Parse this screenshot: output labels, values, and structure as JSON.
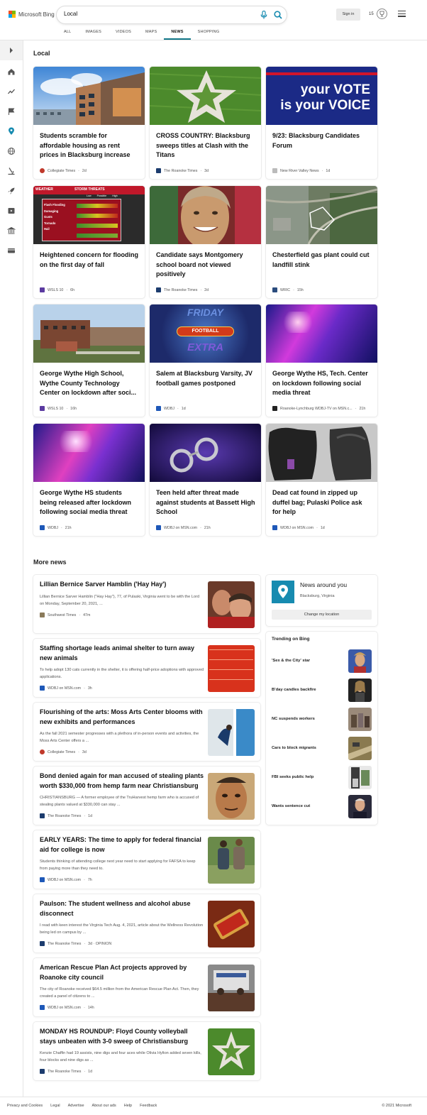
{
  "header": {
    "brand": "Microsoft Bing",
    "search_value": "Local",
    "signin_label": "Sign in",
    "rewards_count": "15"
  },
  "tabs": [
    {
      "label": "ALL"
    },
    {
      "label": "IMAGES"
    },
    {
      "label": "VIDEOS"
    },
    {
      "label": "MAPS"
    },
    {
      "label": "NEWS"
    },
    {
      "label": "SHOPPING"
    }
  ],
  "active_tab": "NEWS",
  "accent_color": "#178bb0",
  "local": {
    "title": "Local",
    "cards": [
      {
        "title": "Students scramble for affordable housing as rent prices in Blacksburg increase",
        "source": "Collegiate Times",
        "age": "2d"
      },
      {
        "title": "CROSS COUNTRY: Blacksburg sweeps titles at Clash with the Titans",
        "source": "The Roanoke Times",
        "age": "3d"
      },
      {
        "title": "9/23: Blacksburg Candidates Forum",
        "source": "New River Valley News",
        "age": "1d",
        "image_text": [
          "your VOTE",
          "is your VOICE"
        ]
      },
      {
        "title": "Heightened concern for flooding on the first day of fall",
        "source": "WSLS 10",
        "age": "6h",
        "image_text": [
          "WEATHER",
          "STORM THREATS",
          "Flash Flooding",
          "Damaging Gusts",
          "Tornado",
          "Hail",
          "Low",
          "Possible",
          "High"
        ]
      },
      {
        "title": "Candidate says Montgomery school board not viewed positively",
        "source": "The Roanoke Times",
        "age": "2d"
      },
      {
        "title": "Chesterfield gas plant could cut landfill stink",
        "source": "WRIC",
        "age": "15h"
      },
      {
        "title": "George Wythe High School, Wythe County Technology Center on lockdown after soci...",
        "source": "WSLS 10",
        "age": "16h"
      },
      {
        "title": "Salem at Blacksburg Varsity, JV football games postponed",
        "source": "WDBJ",
        "age": "1d",
        "image_text": [
          "FRIDAY",
          "FOOTBALL",
          "EXTRA"
        ]
      },
      {
        "title": "George Wythe HS, Tech. Center on lockdown following social media threat",
        "source": "Roanoke-Lynchburg WDBJ-TV on MSN.c...",
        "age": "21h"
      },
      {
        "title": "George Wythe HS students being released after lockdown following social media threat",
        "source": "WDBJ",
        "age": "21h"
      },
      {
        "title": "Teen held after threat made against students at Bassett High School",
        "source": "WDBJ on MSN.com",
        "age": "21h"
      },
      {
        "title": "Dead cat found in zipped up duffel bag; Pulaski Police ask for help",
        "source": "WDBJ on MSN.com",
        "age": "1d"
      }
    ]
  },
  "more_news": {
    "title": "More news",
    "items": [
      {
        "title": "Lillian Bernice Sarver Hamblin ('Hay Hay')",
        "snippet": "Lillian Bernice Sarver Hamblin (\"Hay Hay\"), 77, of Pulaski, Virginia went to be with the Lord on Monday, September 20, 2021, ...",
        "source": "Southwest Times",
        "age": "47m"
      },
      {
        "title": "Staffing shortage leads animal shelter to turn away new animals",
        "snippet": "To help adopt 130 cats currently in the shelter, it is offering half-price adoptions with approved applications.",
        "source": "WDBJ on MSN.com",
        "age": "3h"
      },
      {
        "title": "Flourishing of the arts: Moss Arts Center blooms with new exhibits and performances",
        "snippet": "As the fall 2021 semester progresses with a plethora of in-person events and activities, the Moss Arts Center offers a ...",
        "source": "Collegiate Times",
        "age": "3d"
      },
      {
        "title": "Bond denied again for man accused of stealing plants worth $330,000 from hemp farm near Christiansburg",
        "snippet": "CHRISTIANSBURG — A former employee of the TruHarvest hemp farm who is accused of stealing plants valued at $330,000 can stay ...",
        "source": "The Roanoke Times",
        "age": "1d"
      },
      {
        "title": "EARLY YEARS: The time to apply for federal financial aid for college is now",
        "snippet": "Students thinking of attending college next year need to start applying for FAFSA to keep from paying more than they need to.",
        "source": "WDBJ on MSN.com",
        "age": "7h"
      },
      {
        "title": "Paulson: The student wellness and alcohol abuse disconnect",
        "snippet": "I read with keen interest the Virginia Tech Aug. 4, 2021, article about the Wellness Revolution being led on campus by ...",
        "source": "The Roanoke Times",
        "age": "3d · OPINION"
      },
      {
        "title": "American Rescue Plan Act projects approved by Roanoke city council",
        "snippet": "The city of Roanoke received $64.5 million from the American Rescue Plan Act. Then, they created a panel of citizens to ...",
        "source": "WDBJ on MSN.com",
        "age": "14h"
      },
      {
        "title": "MONDAY HS ROUNDUP: Floyd County volleyball stays unbeaten with 3-0 sweep of Christiansburg",
        "snippet": "Kenzie Chaffin had 19 assists, nine digs and four aces while Olivia Hylton added seven kills, four blocks and nine digs as ...",
        "source": "The Roanoke Times",
        "age": "1d"
      }
    ]
  },
  "news_around": {
    "title": "News around you",
    "location": "Blacksburg, Virginia",
    "change_label": "Change my location"
  },
  "trending": {
    "title": "Trending on Bing",
    "items": [
      {
        "label": "'Sex & the City' star"
      },
      {
        "label": "B'day candles backfire"
      },
      {
        "label": "NC suspends workers"
      },
      {
        "label": "Cars to block migrants"
      },
      {
        "label": "FBI seeks public help"
      },
      {
        "label": "Wants sentence cut"
      }
    ]
  },
  "footer": {
    "links": [
      "Privacy and Cookies",
      "Legal",
      "Advertise",
      "About our ads",
      "Help",
      "Feedback"
    ],
    "copyright": "© 2021 Microsoft"
  }
}
